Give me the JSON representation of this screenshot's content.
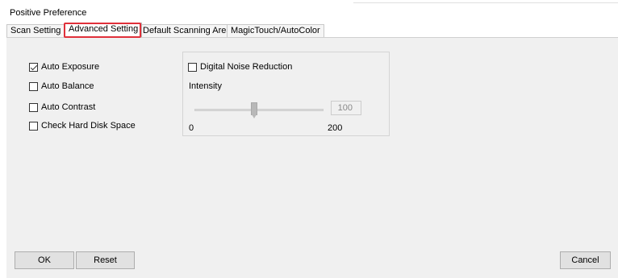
{
  "window": {
    "title": "Positive Preference"
  },
  "tabs": [
    {
      "label": "Scan Setting"
    },
    {
      "label": "Advanced Setting",
      "active": true
    },
    {
      "label": "Default Scanning Area"
    },
    {
      "label": "MagicTouch/AutoColor"
    }
  ],
  "options": {
    "auto_exposure": {
      "label": "Auto Exposure",
      "checked": true
    },
    "auto_balance": {
      "label": "Auto Balance",
      "checked": false
    },
    "auto_contrast": {
      "label": "Auto Contrast",
      "checked": false
    },
    "check_disk": {
      "label": "Check Hard Disk Space",
      "checked": false
    }
  },
  "noise": {
    "label": "Digital Noise Reduction",
    "checked": false,
    "intensity_label": "Intensity",
    "value": "100",
    "min_label": "0",
    "max_label": "200",
    "level": 100
  },
  "buttons": {
    "ok": "OK",
    "reset": "Reset",
    "cancel": "Cancel"
  },
  "colors": {
    "highlight": "#e0303a",
    "panel": "#f0f0f0",
    "button": "#e1e1e1"
  }
}
